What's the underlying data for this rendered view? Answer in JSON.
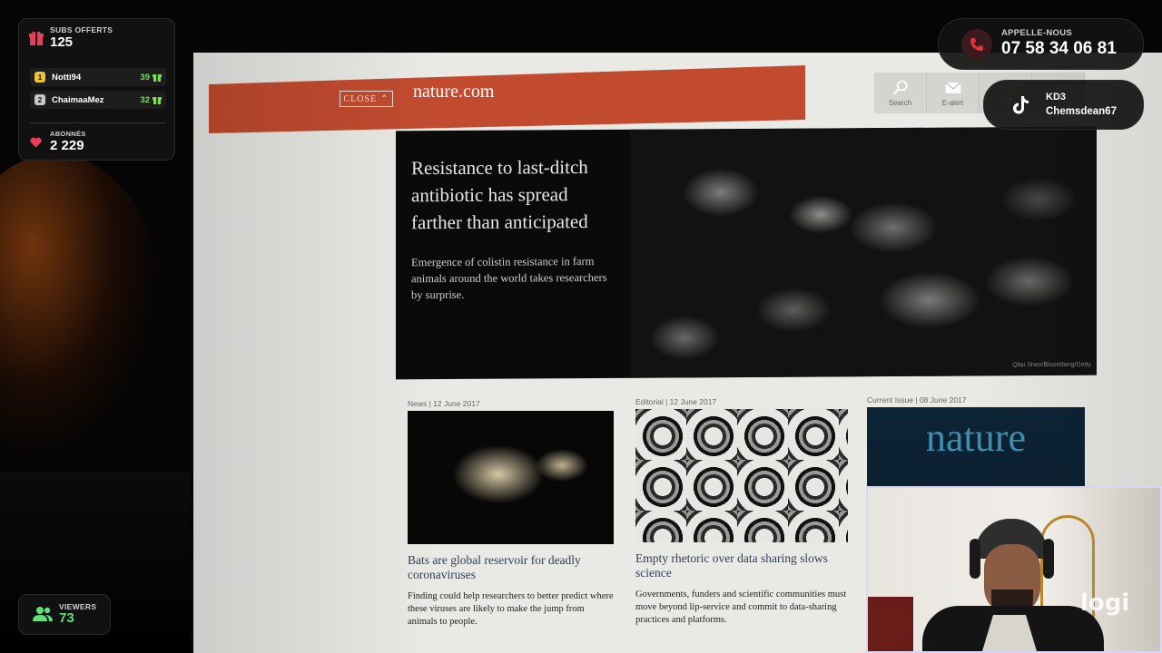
{
  "site": {
    "close_label": "CLOSE",
    "brand": "nature.com",
    "tools": [
      {
        "label": "Search",
        "icon": "search-icon"
      },
      {
        "label": "E-alert",
        "icon": "mail-icon"
      },
      {
        "label": "",
        "icon": "document-icon"
      },
      {
        "label": "",
        "icon": "user-icon"
      }
    ],
    "hero": {
      "title": "Resistance to last-ditch antibiotic has spread farther than anticipated",
      "subtitle": "Emergence of colistin resistance in farm animals around the world takes researchers by surprise.",
      "credit": "Qilai Shen/Bloomberg/Getty"
    },
    "cards": [
      {
        "meta": "News | 12 June 2017",
        "title": "Bats are global reservoir for deadly coronaviruses",
        "summary": "Finding could help researchers to better predict where these viruses are likely to make the jump from animals to people."
      },
      {
        "meta": "Editorial | 12 June 2017",
        "title": "Empty rhetoric over data sharing slows science",
        "summary": "Governments, funders and scientific communities must move beyond lip-service and commit to data-sharing practices and platforms."
      },
      {
        "meta": "Current Issue  |  08 June 2017",
        "cover_title": "nature"
      }
    ]
  },
  "overlay": {
    "subs": {
      "label": "SUBS OFFERTS",
      "value": "125",
      "leaders": [
        {
          "rank": "1",
          "name": "Notti94",
          "count": "39",
          "rank_color": "#f2c230"
        },
        {
          "rank": "2",
          "name": "ChaimaaMez",
          "count": "32",
          "rank_color": "#c9c9c9"
        }
      ],
      "followers_label": "ABONNÉS",
      "followers_value": "2 229"
    },
    "viewers": {
      "label": "VIEWERS",
      "value": "73"
    },
    "call": {
      "label": "APPELLE-NOUS",
      "number": "07 58 34 06 81"
    },
    "tiktok": {
      "line1": "KD3",
      "line2": "Chemsdean67"
    },
    "webcam_brand": "logi"
  },
  "colors": {
    "nature_red": "#c24b2f",
    "accent_green": "#7ddc55",
    "gift_red": "#e8405a",
    "phone_red": "#e0343c"
  }
}
